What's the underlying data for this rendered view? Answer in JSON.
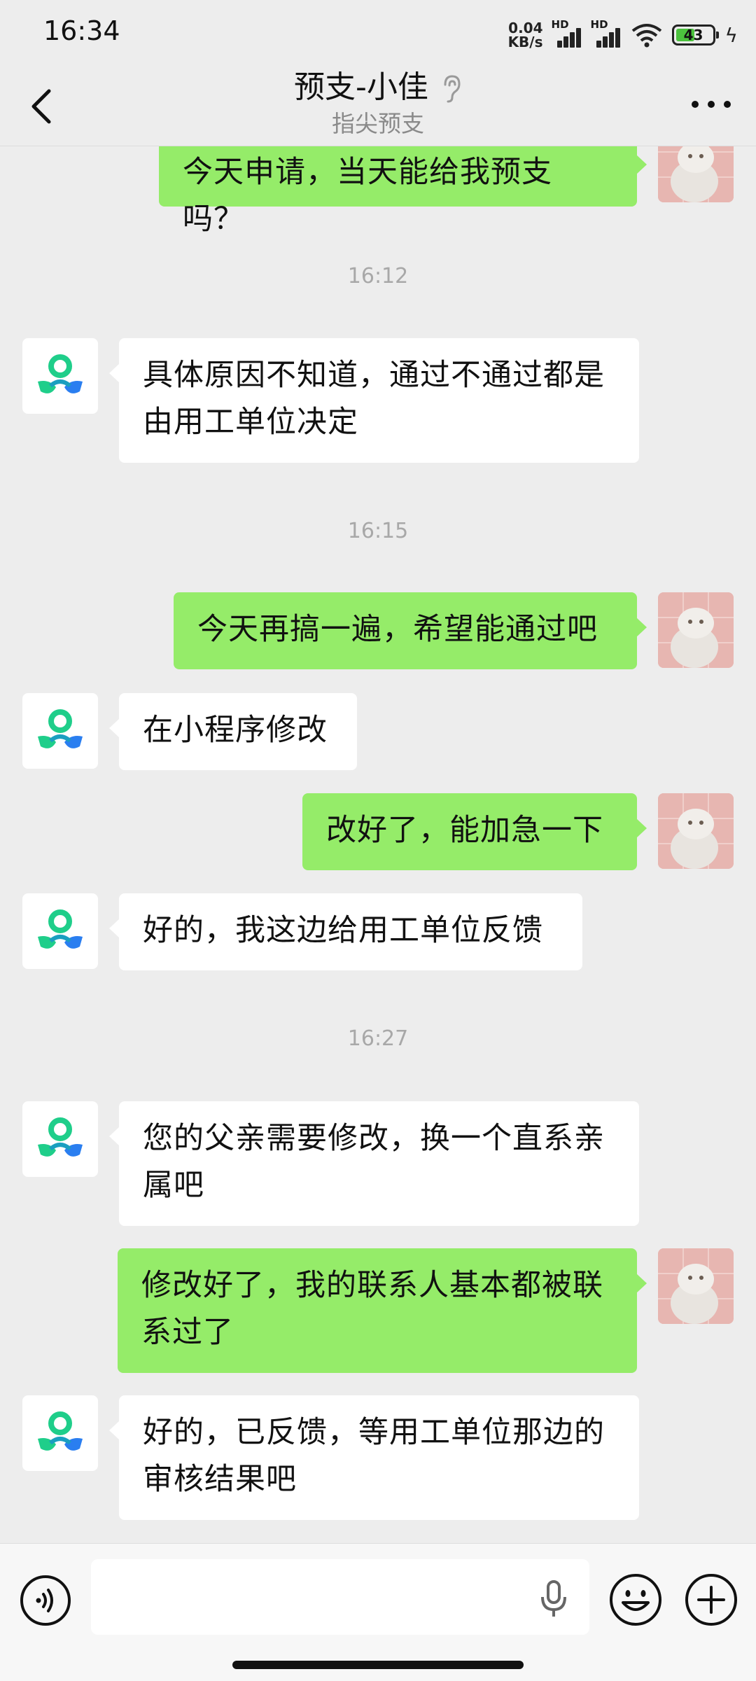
{
  "status_bar": {
    "time": "16:34",
    "net_speed_value": "0.04",
    "net_speed_unit": "KB/s",
    "signal_1_label": "HD",
    "signal_2_label": "HD",
    "battery": "43",
    "icons": [
      "signal-icon",
      "wifi-icon",
      "battery-icon",
      "charging-icon"
    ]
  },
  "header": {
    "title": "预支-小佳",
    "subtitle": "指尖预支",
    "icons": [
      "back-icon",
      "earpiece-mode-icon",
      "more-icon"
    ]
  },
  "messages": [
    {
      "side": "out",
      "text": "今天申请，当天能给我预支吗？"
    },
    {
      "type": "time",
      "text": "16:12"
    },
    {
      "side": "in",
      "text": "具体原因不知道，通过不通过都是由用工单位决定"
    },
    {
      "type": "time",
      "text": "16:15"
    },
    {
      "side": "out",
      "text": "今天再搞一遍，希望能通过吧"
    },
    {
      "side": "in",
      "text": "在小程序修改"
    },
    {
      "side": "out",
      "text": "改好了，能加急一下"
    },
    {
      "side": "in",
      "text": "好的，我这边给用工单位反馈"
    },
    {
      "type": "time",
      "text": "16:27"
    },
    {
      "side": "in",
      "text": "您的父亲需要修改，换一个直系亲属吧"
    },
    {
      "side": "out",
      "text": "修改好了，我的联系人基本都被联系过了"
    },
    {
      "side": "in",
      "text": "好的，已反馈，等用工单位那边的审核结果吧"
    }
  ],
  "input_bar": {
    "placeholder": "",
    "icons": [
      "voice-icon",
      "microphone-icon",
      "emoji-icon",
      "plus-icon"
    ]
  },
  "colors": {
    "background": "#ededed",
    "outgoing_bubble": "#95ec69",
    "incoming_bubble": "#ffffff",
    "bot_logo_green": "#1fce8a",
    "bot_logo_blue": "#2a7ef0"
  }
}
